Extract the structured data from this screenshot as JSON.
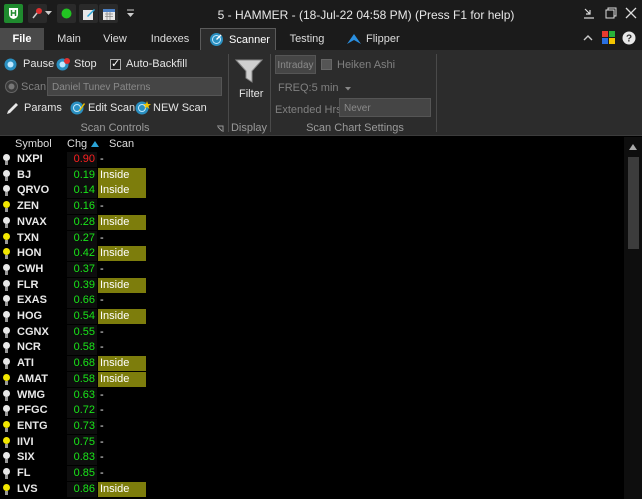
{
  "window": {
    "title": "5 - HAMMER - (18-Jul-22 04:58 PM) (Press F1 for help)",
    "controls": {
      "minimize": "minimize-icon",
      "restore": "restore-icon",
      "close": "close-icon"
    }
  },
  "quick_access": [
    "shield-icon",
    "pin-icon",
    "green-circle-icon",
    "edit-icon",
    "calendar-icon",
    "dropdown-arrow-icon"
  ],
  "tabs": [
    {
      "label": "File",
      "active": false
    },
    {
      "label": "Main",
      "active": false
    },
    {
      "label": "View",
      "active": false
    },
    {
      "label": "Indexes",
      "active": false
    },
    {
      "label": "Scanner",
      "active": true
    },
    {
      "label": "Testing",
      "active": false
    },
    {
      "label": "Flipper",
      "active": false
    }
  ],
  "ribbon": {
    "pause_label": "Pause",
    "stop_label": "Stop",
    "auto_backfill_label": "Auto-Backfill",
    "auto_backfill_checked": true,
    "scan_label": "Scan",
    "scan_name_value": "Daniel Tunev Patterns",
    "params_label": "Params",
    "edit_scan_label": "Edit Scan",
    "new_scan_label": "NEW Scan",
    "scan_controls_label": "Scan Controls",
    "filter_label": "Filter",
    "display_label": "Display",
    "intraday_label": "Intraday",
    "heiken_ashi_label": "Heiken Ashi",
    "heiken_ashi_checked": false,
    "freq_label": "FREQ:5 min",
    "extended_hrs_label": "Extended Hrs:",
    "extended_hrs_value": "Never",
    "scan_chart_settings_label": "Scan Chart Settings"
  },
  "scanner": {
    "columns": {
      "symbol": "Symbol",
      "chg": "Chg",
      "scan": "Scan"
    },
    "rows": [
      {
        "symbol": "NXPI",
        "chg": "0.90",
        "scan": "-",
        "hit": false,
        "bulb": "white",
        "chg_color": "#ff2020"
      },
      {
        "symbol": "BJ",
        "chg": "0.19",
        "scan": "Inside",
        "hit": true,
        "bulb": "white",
        "chg_color": "#19e619"
      },
      {
        "symbol": "QRVO",
        "chg": "0.14",
        "scan": "Inside",
        "hit": true,
        "bulb": "white",
        "chg_color": "#19e619"
      },
      {
        "symbol": "ZEN",
        "chg": "0.16",
        "scan": "-",
        "hit": false,
        "bulb": "yellow",
        "chg_color": "#19e619"
      },
      {
        "symbol": "NVAX",
        "chg": "0.28",
        "scan": "Inside",
        "hit": true,
        "bulb": "white",
        "chg_color": "#19e619"
      },
      {
        "symbol": "TXN",
        "chg": "0.27",
        "scan": "-",
        "hit": false,
        "bulb": "yellow",
        "chg_color": "#19e619"
      },
      {
        "symbol": "HON",
        "chg": "0.42",
        "scan": "Inside",
        "hit": true,
        "bulb": "yellow",
        "chg_color": "#19e619"
      },
      {
        "symbol": "CWH",
        "chg": "0.37",
        "scan": "-",
        "hit": false,
        "bulb": "white",
        "chg_color": "#19e619"
      },
      {
        "symbol": "FLR",
        "chg": "0.39",
        "scan": "Inside",
        "hit": true,
        "bulb": "white",
        "chg_color": "#19e619"
      },
      {
        "symbol": "EXAS",
        "chg": "0.66",
        "scan": "-",
        "hit": false,
        "bulb": "white",
        "chg_color": "#19e619"
      },
      {
        "symbol": "HOG",
        "chg": "0.54",
        "scan": "Inside",
        "hit": true,
        "bulb": "white",
        "chg_color": "#19e619"
      },
      {
        "symbol": "CGNX",
        "chg": "0.55",
        "scan": "-",
        "hit": false,
        "bulb": "white",
        "chg_color": "#19e619"
      },
      {
        "symbol": "NCR",
        "chg": "0.58",
        "scan": "-",
        "hit": false,
        "bulb": "white",
        "chg_color": "#19e619"
      },
      {
        "symbol": "ATI",
        "chg": "0.68",
        "scan": "Inside",
        "hit": true,
        "bulb": "white",
        "chg_color": "#19e619"
      },
      {
        "symbol": "AMAT",
        "chg": "0.58",
        "scan": "Inside",
        "hit": true,
        "bulb": "yellow",
        "chg_color": "#19e619"
      },
      {
        "symbol": "WMG",
        "chg": "0.63",
        "scan": "-",
        "hit": false,
        "bulb": "white",
        "chg_color": "#19e619"
      },
      {
        "symbol": "PFGC",
        "chg": "0.72",
        "scan": "-",
        "hit": false,
        "bulb": "white",
        "chg_color": "#19e619"
      },
      {
        "symbol": "ENTG",
        "chg": "0.73",
        "scan": "-",
        "hit": false,
        "bulb": "yellow",
        "chg_color": "#19e619"
      },
      {
        "symbol": "IIVI",
        "chg": "0.75",
        "scan": "-",
        "hit": false,
        "bulb": "yellow",
        "chg_color": "#19e619"
      },
      {
        "symbol": "SIX",
        "chg": "0.83",
        "scan": "-",
        "hit": false,
        "bulb": "white",
        "chg_color": "#19e619"
      },
      {
        "symbol": "FL",
        "chg": "0.85",
        "scan": "-",
        "hit": false,
        "bulb": "white",
        "chg_color": "#19e619"
      },
      {
        "symbol": "LVS",
        "chg": "0.86",
        "scan": "Inside",
        "hit": true,
        "bulb": "yellow",
        "chg_color": "#19e619"
      }
    ]
  },
  "colors": {
    "scan_hit_bg": "#7d7d0c",
    "bulb_white": "#e8e8e8",
    "bulb_yellow": "#f2e600",
    "accent": "#2aa3d6"
  }
}
